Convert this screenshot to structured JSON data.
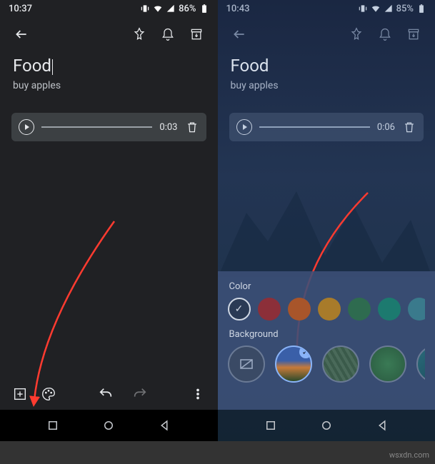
{
  "left": {
    "status": {
      "time": "10:37",
      "battery": "86%"
    },
    "note": {
      "title": "Food",
      "body": "buy apples"
    },
    "audio": {
      "duration": "0:03"
    }
  },
  "right": {
    "status": {
      "time": "10:43",
      "battery": "85%"
    },
    "note": {
      "title": "Food",
      "body": "buy apples"
    },
    "audio": {
      "duration": "0:06"
    },
    "picker": {
      "color_label": "Color",
      "background_label": "Background",
      "colors": [
        "#202124",
        "#8c2f2f",
        "#a8552a",
        "#a87b2a",
        "#2e6b4f",
        "#1c7a6f",
        "#3a7a8c",
        "#3a5a8c"
      ]
    }
  },
  "watermark": "wsxdn.com"
}
